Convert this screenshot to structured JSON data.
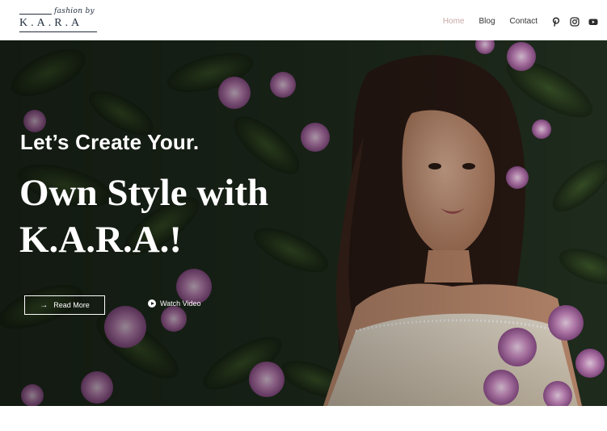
{
  "brand": {
    "script": "fashion by",
    "letters": "K.A.R.A",
    "colors": {
      "accent": "#c9a7a7",
      "dark": "#243040"
    }
  },
  "nav": {
    "items": [
      {
        "label": "Home",
        "active": true
      },
      {
        "label": "Blog",
        "active": false
      },
      {
        "label": "Contact",
        "active": false
      }
    ],
    "social": [
      "pinterest-icon",
      "instagram-icon",
      "youtube-icon"
    ]
  },
  "hero": {
    "subheading": "Let’s Create Your.",
    "headline_line1": "Own Style with",
    "headline_line2": "K.A.R.A.!",
    "read_more_label": "Read More",
    "watch_video_label": "Watch Video"
  }
}
